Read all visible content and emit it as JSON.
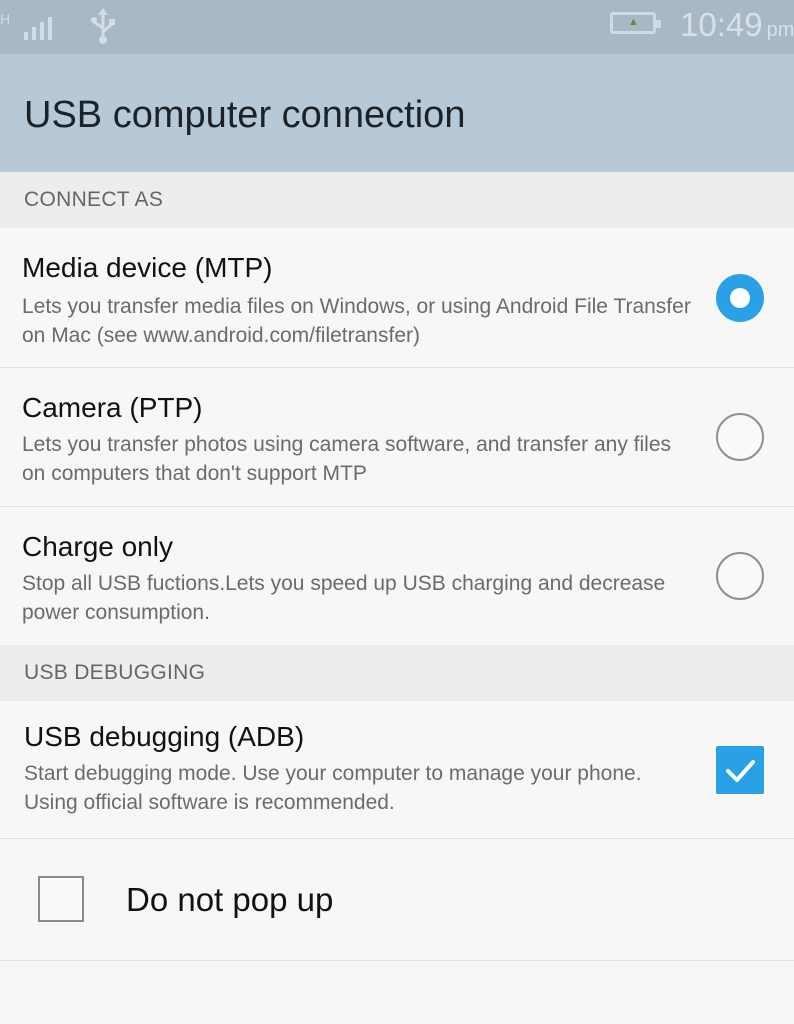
{
  "status_bar": {
    "signal_icon": "signal-icon",
    "usb_icon": "usb-icon",
    "battery_icon": "battery-charging-icon",
    "time": "10:49",
    "ampm": "pm"
  },
  "app_bar": {
    "title": "USB computer connection"
  },
  "connect_as": {
    "header": "CONNECT AS",
    "options": [
      {
        "title": "Media device (MTP)",
        "description": "Lets you transfer media files on Windows, or using Android File Transfer on Mac (see www.android.com/filetransfer)",
        "selected": true
      },
      {
        "title": "Camera (PTP)",
        "description": "Lets you transfer photos using camera software, and transfer any files on computers that don't support MTP",
        "selected": false
      },
      {
        "title": "Charge only",
        "description": "Stop all USB fuctions.Lets you speed up USB charging and decrease power consumption.",
        "selected": false
      }
    ]
  },
  "usb_debugging": {
    "header": "USB DEBUGGING",
    "title": "USB debugging (ADB)",
    "description": "Start debugging mode. Use your computer to manage your phone. Using official software is recommended.",
    "checked": true
  },
  "do_not_popup": {
    "label": "Do not pop up",
    "checked": false
  },
  "colors": {
    "accent": "#29a1e6",
    "app_bar": "#b7c8d6",
    "status_bar": "#a9b8c5"
  }
}
